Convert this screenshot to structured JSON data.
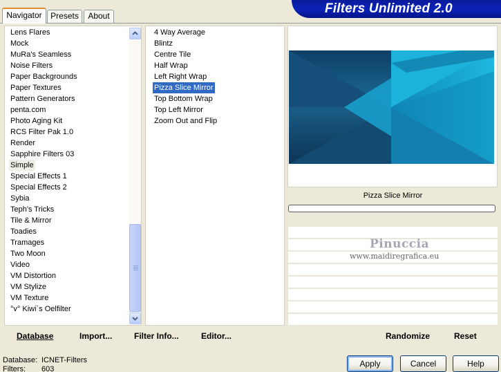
{
  "tabs": [
    {
      "label": "Navigator",
      "active": true
    },
    {
      "label": "Presets",
      "active": false
    },
    {
      "label": "About",
      "active": false
    }
  ],
  "banner": {
    "title": "Filters Unlimited 2.0"
  },
  "categories": {
    "items": [
      "Lens Flares",
      "Mock",
      "MuRa's Seamless",
      "Noise Filters",
      "Paper Backgrounds",
      "Paper Textures",
      "Pattern Generators",
      "penta.com",
      "Photo Aging Kit",
      "RCS Filter Pak 1.0",
      "Render",
      "Sapphire Filters 03",
      "Simple",
      "Special Effects 1",
      "Special Effects 2",
      "Sybia",
      "Teph's Tricks",
      "Tile & Mirror",
      "Toadies",
      "Tramages",
      "Two Moon",
      "Video",
      "VM Distortion",
      "VM Stylize",
      "VM Texture",
      "°v° Kiwi`s Oelfilter"
    ],
    "selected": "Simple",
    "scroll_position": 0.74
  },
  "filters": {
    "items": [
      "4 Way Average",
      "Blintz",
      "Centre Tile",
      "Half Wrap",
      "Left Right Wrap",
      "Pizza Slice Mirror",
      "Top Bottom Wrap",
      "Top Left Mirror",
      "Zoom Out and Flip"
    ],
    "selected": "Pizza Slice Mirror"
  },
  "preview": {
    "filter_name": "Pizza Slice Mirror",
    "progress": 0,
    "watermark_name": "Pinuccia",
    "watermark_url": "www.maidiregrafica.eu",
    "colors": {
      "dark": "#0e3c63",
      "mid": "#1a6e97",
      "bright": "#1eb8e0"
    }
  },
  "toolbar": {
    "database": "Database",
    "import": "Import...",
    "filter_info": "Filter Info...",
    "editor": "Editor...",
    "randomize": "Randomize",
    "reset": "Reset"
  },
  "status": {
    "database_label": "Database:",
    "database_value": "ICNET-Filters",
    "filters_label": "Filters:",
    "filters_value": "603"
  },
  "buttons": {
    "apply": "Apply",
    "cancel": "Cancel",
    "help": "Help"
  }
}
